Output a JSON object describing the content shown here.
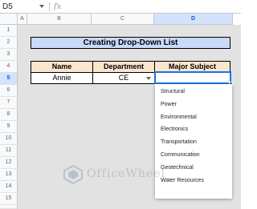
{
  "formula_bar": {
    "cell_ref": "D5",
    "fx_label": "fx"
  },
  "columns": [
    "A",
    "B",
    "C",
    "D"
  ],
  "rows": [
    "1",
    "2",
    "3",
    "4",
    "5",
    "6",
    "7",
    "8",
    "9",
    "10",
    "11",
    "12",
    "13",
    "14",
    "15",
    "16"
  ],
  "selected": {
    "column": "D",
    "row": "5"
  },
  "sheet": {
    "title": "Creating Drop-Down List",
    "headers": [
      "Name",
      "Department",
      "Major Subject"
    ],
    "row": {
      "name": "Annie",
      "department": "CE",
      "major": ""
    }
  },
  "dropdown_options": [
    "Structural",
    "Power",
    "Environmental",
    "Electronics",
    "Transportation",
    "Communication",
    "Geotechnical",
    "Water Resources"
  ],
  "watermark": {
    "text": "OfficeWheel",
    "color": "#8a9bb0"
  },
  "colors": {
    "title_fill": "#c9daf8",
    "header_fill": "#fce5cd",
    "selection_blue": "#1a73e8"
  }
}
